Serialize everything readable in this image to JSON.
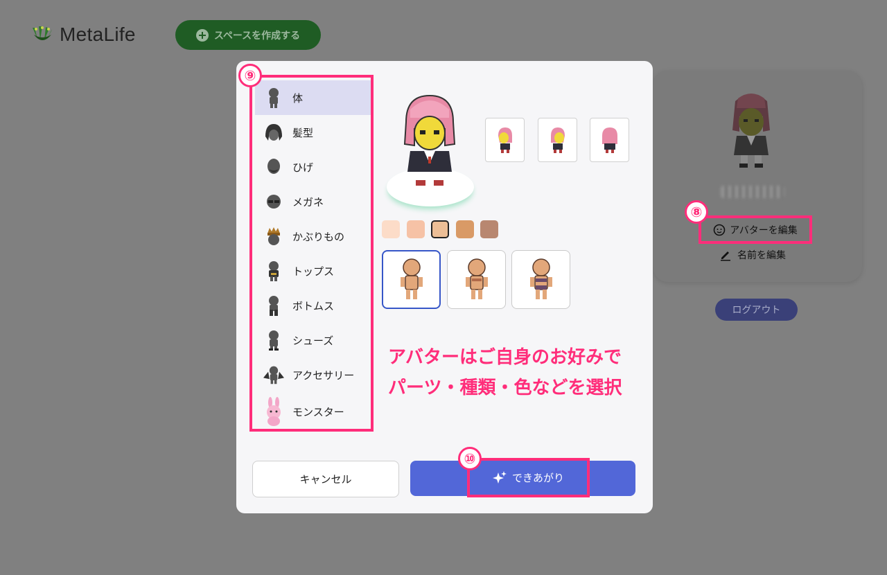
{
  "app": {
    "name": "MetaLife",
    "create_space_label": "スペースを作成する"
  },
  "profile": {
    "edit_avatar_label": "アバターを編集",
    "edit_name_label": "名前を編集",
    "logout_label": "ログアウト"
  },
  "annotations": {
    "badge_8": "⑧",
    "badge_9": "⑨",
    "badge_10": "⑩",
    "caption_line1": "アバターはご自身のお好みで",
    "caption_line2": "パーツ・種類・色などを選択",
    "highlight_color": "#ff2d7a"
  },
  "editor": {
    "parts": [
      {
        "label": "体",
        "icon": "body-icon",
        "selected": true
      },
      {
        "label": "髪型",
        "icon": "hair-icon",
        "selected": false
      },
      {
        "label": "ひげ",
        "icon": "beard-icon",
        "selected": false
      },
      {
        "label": "メガネ",
        "icon": "glasses-icon",
        "selected": false
      },
      {
        "label": "かぶりもの",
        "icon": "headwear-icon",
        "selected": false
      },
      {
        "label": "トップス",
        "icon": "tops-icon",
        "selected": false
      },
      {
        "label": "ボトムス",
        "icon": "bottoms-icon",
        "selected": false
      },
      {
        "label": "シューズ",
        "icon": "shoes-icon",
        "selected": false
      },
      {
        "label": "アクセサリー",
        "icon": "accessory-icon",
        "selected": false
      },
      {
        "label": "モンスター",
        "icon": "monster-icon",
        "selected": false
      }
    ],
    "skin_colors": [
      "#fcdcc8",
      "#f6c2a6",
      "#ecbe96",
      "#d99a66",
      "#b88770"
    ],
    "selected_skin_index": 2,
    "body_types": [
      "body-type-1",
      "body-type-2",
      "body-type-3"
    ],
    "selected_body_index": 0,
    "cancel_label": "キャンセル",
    "done_label": "できあがり",
    "accent_color": "#5267d8"
  }
}
